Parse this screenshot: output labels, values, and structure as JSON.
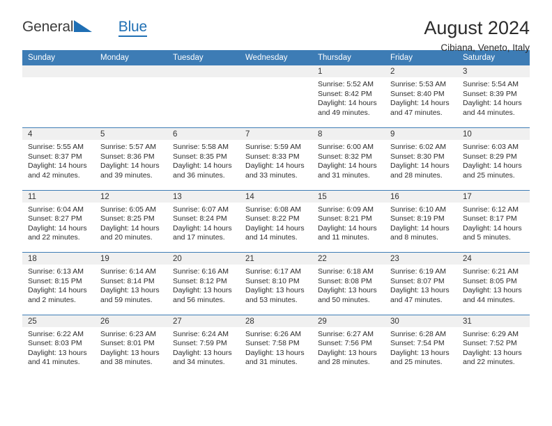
{
  "brand": {
    "line1": "General",
    "line2": "Blue",
    "triangle_color": "#1f6fb4"
  },
  "header": {
    "title": "August 2024",
    "subtitle": "Cibiana, Veneto, Italy"
  },
  "theme": {
    "header_blue": "#3d7cb5",
    "daynum_bg": "#f0f0f0",
    "text": "#2c2c2c"
  },
  "weekdays": [
    "Sunday",
    "Monday",
    "Tuesday",
    "Wednesday",
    "Thursday",
    "Friday",
    "Saturday"
  ],
  "weeks": [
    [
      {
        "day": "",
        "sunrise": "",
        "sunset": "",
        "daylight1": "",
        "daylight2": ""
      },
      {
        "day": "",
        "sunrise": "",
        "sunset": "",
        "daylight1": "",
        "daylight2": ""
      },
      {
        "day": "",
        "sunrise": "",
        "sunset": "",
        "daylight1": "",
        "daylight2": ""
      },
      {
        "day": "",
        "sunrise": "",
        "sunset": "",
        "daylight1": "",
        "daylight2": ""
      },
      {
        "day": "1",
        "sunrise": "Sunrise: 5:52 AM",
        "sunset": "Sunset: 8:42 PM",
        "daylight1": "Daylight: 14 hours",
        "daylight2": "and 49 minutes."
      },
      {
        "day": "2",
        "sunrise": "Sunrise: 5:53 AM",
        "sunset": "Sunset: 8:40 PM",
        "daylight1": "Daylight: 14 hours",
        "daylight2": "and 47 minutes."
      },
      {
        "day": "3",
        "sunrise": "Sunrise: 5:54 AM",
        "sunset": "Sunset: 8:39 PM",
        "daylight1": "Daylight: 14 hours",
        "daylight2": "and 44 minutes."
      }
    ],
    [
      {
        "day": "4",
        "sunrise": "Sunrise: 5:55 AM",
        "sunset": "Sunset: 8:37 PM",
        "daylight1": "Daylight: 14 hours",
        "daylight2": "and 42 minutes."
      },
      {
        "day": "5",
        "sunrise": "Sunrise: 5:57 AM",
        "sunset": "Sunset: 8:36 PM",
        "daylight1": "Daylight: 14 hours",
        "daylight2": "and 39 minutes."
      },
      {
        "day": "6",
        "sunrise": "Sunrise: 5:58 AM",
        "sunset": "Sunset: 8:35 PM",
        "daylight1": "Daylight: 14 hours",
        "daylight2": "and 36 minutes."
      },
      {
        "day": "7",
        "sunrise": "Sunrise: 5:59 AM",
        "sunset": "Sunset: 8:33 PM",
        "daylight1": "Daylight: 14 hours",
        "daylight2": "and 33 minutes."
      },
      {
        "day": "8",
        "sunrise": "Sunrise: 6:00 AM",
        "sunset": "Sunset: 8:32 PM",
        "daylight1": "Daylight: 14 hours",
        "daylight2": "and 31 minutes."
      },
      {
        "day": "9",
        "sunrise": "Sunrise: 6:02 AM",
        "sunset": "Sunset: 8:30 PM",
        "daylight1": "Daylight: 14 hours",
        "daylight2": "and 28 minutes."
      },
      {
        "day": "10",
        "sunrise": "Sunrise: 6:03 AM",
        "sunset": "Sunset: 8:29 PM",
        "daylight1": "Daylight: 14 hours",
        "daylight2": "and 25 minutes."
      }
    ],
    [
      {
        "day": "11",
        "sunrise": "Sunrise: 6:04 AM",
        "sunset": "Sunset: 8:27 PM",
        "daylight1": "Daylight: 14 hours",
        "daylight2": "and 22 minutes."
      },
      {
        "day": "12",
        "sunrise": "Sunrise: 6:05 AM",
        "sunset": "Sunset: 8:25 PM",
        "daylight1": "Daylight: 14 hours",
        "daylight2": "and 20 minutes."
      },
      {
        "day": "13",
        "sunrise": "Sunrise: 6:07 AM",
        "sunset": "Sunset: 8:24 PM",
        "daylight1": "Daylight: 14 hours",
        "daylight2": "and 17 minutes."
      },
      {
        "day": "14",
        "sunrise": "Sunrise: 6:08 AM",
        "sunset": "Sunset: 8:22 PM",
        "daylight1": "Daylight: 14 hours",
        "daylight2": "and 14 minutes."
      },
      {
        "day": "15",
        "sunrise": "Sunrise: 6:09 AM",
        "sunset": "Sunset: 8:21 PM",
        "daylight1": "Daylight: 14 hours",
        "daylight2": "and 11 minutes."
      },
      {
        "day": "16",
        "sunrise": "Sunrise: 6:10 AM",
        "sunset": "Sunset: 8:19 PM",
        "daylight1": "Daylight: 14 hours",
        "daylight2": "and 8 minutes."
      },
      {
        "day": "17",
        "sunrise": "Sunrise: 6:12 AM",
        "sunset": "Sunset: 8:17 PM",
        "daylight1": "Daylight: 14 hours",
        "daylight2": "and 5 minutes."
      }
    ],
    [
      {
        "day": "18",
        "sunrise": "Sunrise: 6:13 AM",
        "sunset": "Sunset: 8:15 PM",
        "daylight1": "Daylight: 14 hours",
        "daylight2": "and 2 minutes."
      },
      {
        "day": "19",
        "sunrise": "Sunrise: 6:14 AM",
        "sunset": "Sunset: 8:14 PM",
        "daylight1": "Daylight: 13 hours",
        "daylight2": "and 59 minutes."
      },
      {
        "day": "20",
        "sunrise": "Sunrise: 6:16 AM",
        "sunset": "Sunset: 8:12 PM",
        "daylight1": "Daylight: 13 hours",
        "daylight2": "and 56 minutes."
      },
      {
        "day": "21",
        "sunrise": "Sunrise: 6:17 AM",
        "sunset": "Sunset: 8:10 PM",
        "daylight1": "Daylight: 13 hours",
        "daylight2": "and 53 minutes."
      },
      {
        "day": "22",
        "sunrise": "Sunrise: 6:18 AM",
        "sunset": "Sunset: 8:08 PM",
        "daylight1": "Daylight: 13 hours",
        "daylight2": "and 50 minutes."
      },
      {
        "day": "23",
        "sunrise": "Sunrise: 6:19 AM",
        "sunset": "Sunset: 8:07 PM",
        "daylight1": "Daylight: 13 hours",
        "daylight2": "and 47 minutes."
      },
      {
        "day": "24",
        "sunrise": "Sunrise: 6:21 AM",
        "sunset": "Sunset: 8:05 PM",
        "daylight1": "Daylight: 13 hours",
        "daylight2": "and 44 minutes."
      }
    ],
    [
      {
        "day": "25",
        "sunrise": "Sunrise: 6:22 AM",
        "sunset": "Sunset: 8:03 PM",
        "daylight1": "Daylight: 13 hours",
        "daylight2": "and 41 minutes."
      },
      {
        "day": "26",
        "sunrise": "Sunrise: 6:23 AM",
        "sunset": "Sunset: 8:01 PM",
        "daylight1": "Daylight: 13 hours",
        "daylight2": "and 38 minutes."
      },
      {
        "day": "27",
        "sunrise": "Sunrise: 6:24 AM",
        "sunset": "Sunset: 7:59 PM",
        "daylight1": "Daylight: 13 hours",
        "daylight2": "and 34 minutes."
      },
      {
        "day": "28",
        "sunrise": "Sunrise: 6:26 AM",
        "sunset": "Sunset: 7:58 PM",
        "daylight1": "Daylight: 13 hours",
        "daylight2": "and 31 minutes."
      },
      {
        "day": "29",
        "sunrise": "Sunrise: 6:27 AM",
        "sunset": "Sunset: 7:56 PM",
        "daylight1": "Daylight: 13 hours",
        "daylight2": "and 28 minutes."
      },
      {
        "day": "30",
        "sunrise": "Sunrise: 6:28 AM",
        "sunset": "Sunset: 7:54 PM",
        "daylight1": "Daylight: 13 hours",
        "daylight2": "and 25 minutes."
      },
      {
        "day": "31",
        "sunrise": "Sunrise: 6:29 AM",
        "sunset": "Sunset: 7:52 PM",
        "daylight1": "Daylight: 13 hours",
        "daylight2": "and 22 minutes."
      }
    ]
  ]
}
